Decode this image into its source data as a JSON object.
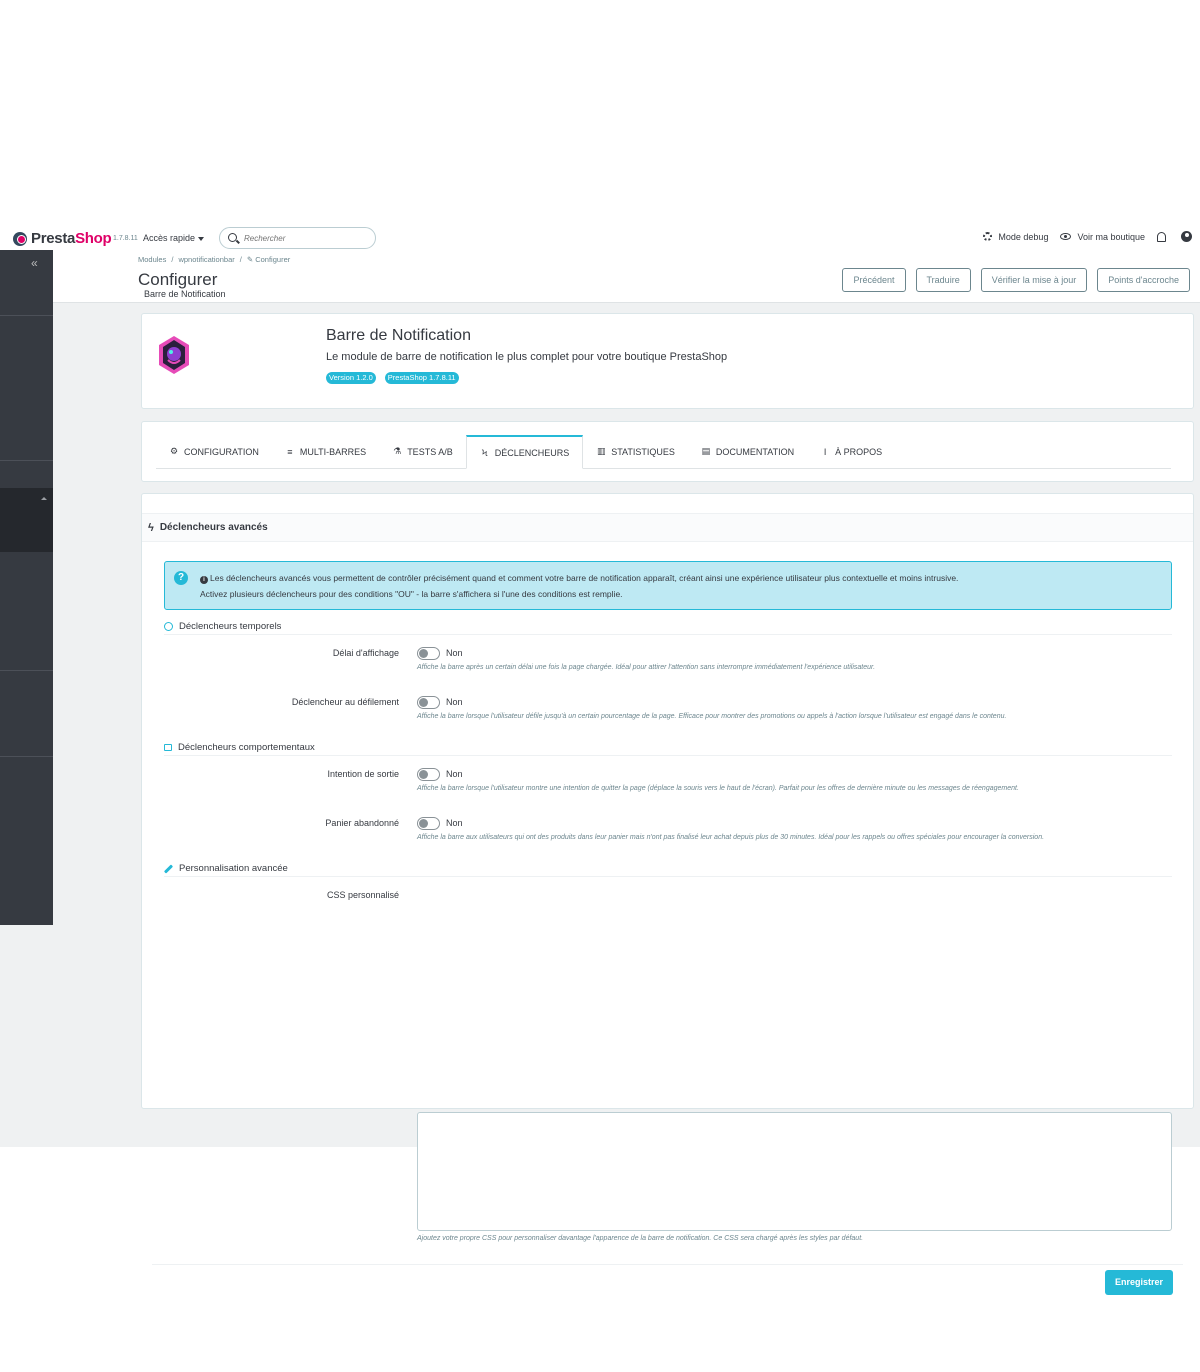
{
  "header": {
    "brand_presta": "Presta",
    "brand_shop": "Shop",
    "version": "1.7.8.11",
    "quick_access": "Accès rapide",
    "search_placeholder": "Rechercher",
    "debug": "Mode debug",
    "view_shop": "Voir ma boutique"
  },
  "sidebar": {
    "toggle": "«"
  },
  "breadcrumb": [
    "Modules",
    "wpnotificationbar",
    "Configurer"
  ],
  "page": {
    "title": "Configurer",
    "subtitle": "Barre de Notification"
  },
  "toolbar": {
    "previous": "Précédent",
    "translate": "Traduire",
    "check_update": "Vérifier la mise à jour",
    "hooks": "Points d'accroche"
  },
  "module": {
    "name": "Barre de Notification",
    "description": "Le module de barre de notification le plus complet pour votre boutique PrestaShop",
    "badge_version": "Version 1.2.0",
    "badge_ps": "PrestaShop 1.7.8.11",
    "logo_icon": "module-logo-icon"
  },
  "tabs": [
    {
      "label": "Configuration",
      "icon": "⚙"
    },
    {
      "label": "Multi-barres",
      "icon": "≡"
    },
    {
      "label": "Tests A/B",
      "icon": "⚗"
    },
    {
      "label": "Déclencheurs",
      "icon": "ϟ"
    },
    {
      "label": "Statistiques",
      "icon": "▥"
    },
    {
      "label": "Documentation",
      "icon": "▤"
    },
    {
      "label": "À propos",
      "icon": "i"
    }
  ],
  "active_tab": "Déclencheurs",
  "panel": {
    "title": "Déclencheurs avancés",
    "alert_line1": "Les déclencheurs avancés vous permettent de contrôler précisément quand et comment votre barre de notification apparaît, créant ainsi une expérience utilisateur plus contextuelle et moins intrusive.",
    "alert_line2": "Activez plusieurs déclencheurs pour des conditions \"OU\" - la barre s'affichera si l'une des conditions est remplie.",
    "section_time": "Déclencheurs temporels",
    "section_behavior": "Déclencheurs comportementaux",
    "section_custom": "Personnalisation avancée",
    "fields": {
      "delay": {
        "label": "Délai d'affichage",
        "value": "Non",
        "help": "Affiche la barre après un certain délai une fois la page chargée. Idéal pour attirer l'attention sans interrompre immédiatement l'expérience utilisateur."
      },
      "scroll": {
        "label": "Déclencheur au défilement",
        "value": "Non",
        "help": "Affiche la barre lorsque l'utilisateur défile jusqu'à un certain pourcentage de la page. Efficace pour montrer des promotions ou appels à l'action lorsque l'utilisateur est engagé dans le contenu."
      },
      "exit": {
        "label": "Intention de sortie",
        "value": "Non",
        "help": "Affiche la barre lorsque l'utilisateur montre une intention de quitter la page (déplace la souris vers le haut de l'écran). Parfait pour les offres de dernière minute ou les messages de réengagement."
      },
      "cart": {
        "label": "Panier abandonné",
        "value": "Non",
        "help": "Affiche la barre aux utilisateurs qui ont des produits dans leur panier mais n'ont pas finalisé leur achat depuis plus de 30 minutes. Idéal pour les rappels ou offres spéciales pour encourager la conversion."
      },
      "css": {
        "label": "CSS personnalisé",
        "value": "",
        "help": "Ajoutez votre propre CSS pour personnaliser davantage l'apparence de la barre de notification. Ce CSS sera chargé après les styles par défaut."
      }
    },
    "save": "Enregistrer"
  },
  "colors": {
    "accent": "#25b9d7",
    "sidebar": "#363a41",
    "brand_pink": "#df0067"
  }
}
